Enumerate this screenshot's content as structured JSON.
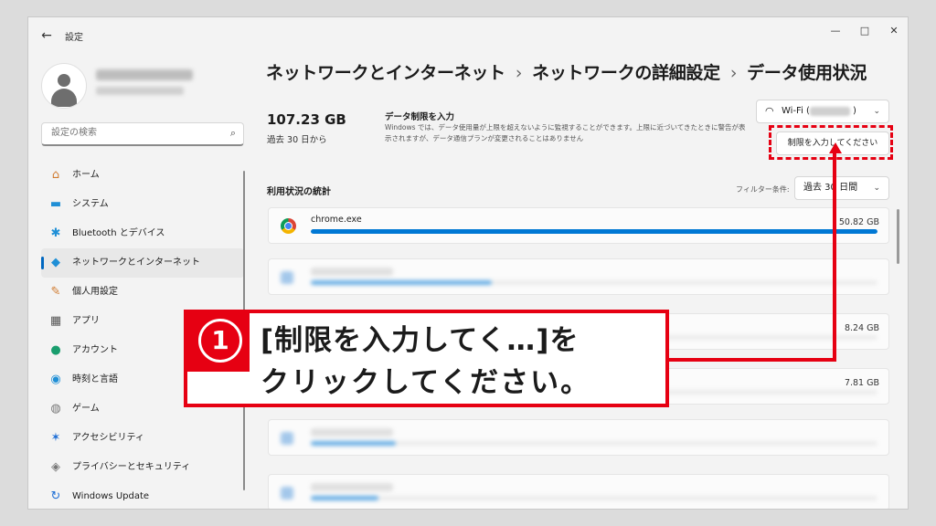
{
  "window": {
    "title": "設定",
    "controls": {
      "minimize": "—",
      "maximize": "□",
      "close": "✕"
    }
  },
  "sidebar": {
    "search_placeholder": "設定の検索",
    "items": [
      {
        "label": "ホーム",
        "icon": "home-icon",
        "glyph": "⌂",
        "color": "#d07a2e",
        "active": false
      },
      {
        "label": "システム",
        "icon": "system-icon",
        "glyph": "▬",
        "color": "#1f8fd6",
        "active": false
      },
      {
        "label": "Bluetooth とデバイス",
        "icon": "bluetooth-icon",
        "glyph": "✱",
        "color": "#1f8fd6",
        "active": false
      },
      {
        "label": "ネットワークとインターネット",
        "icon": "wifi-icon",
        "glyph": "◆",
        "color": "#1f8fd6",
        "active": true
      },
      {
        "label": "個人用設定",
        "icon": "brush-icon",
        "glyph": "✎",
        "color": "#d07a2e",
        "active": false
      },
      {
        "label": "アプリ",
        "icon": "apps-icon",
        "glyph": "▦",
        "color": "#555555",
        "active": false
      },
      {
        "label": "アカウント",
        "icon": "account-icon",
        "glyph": "●",
        "color": "#1a9e6e",
        "active": false
      },
      {
        "label": "時刻と言語",
        "icon": "globe-icon",
        "glyph": "◉",
        "color": "#1f8fd6",
        "active": false
      },
      {
        "label": "ゲーム",
        "icon": "gamepad-icon",
        "glyph": "◍",
        "color": "#777777",
        "active": false
      },
      {
        "label": "アクセシビリティ",
        "icon": "accessibility-icon",
        "glyph": "✶",
        "color": "#1f6fd6",
        "active": false
      },
      {
        "label": "プライバシーとセキュリティ",
        "icon": "shield-icon",
        "glyph": "◈",
        "color": "#777777",
        "active": false
      },
      {
        "label": "Windows Update",
        "icon": "update-icon",
        "glyph": "↻",
        "color": "#1f6fd6",
        "active": false
      }
    ]
  },
  "breadcrumb": {
    "part1": "ネットワークとインターネット",
    "part2": "ネットワークの詳細設定",
    "part3": "データ使用状況",
    "separator": "›"
  },
  "usage": {
    "amount": "107.23 GB",
    "period": "過去 30 日から"
  },
  "data_limit": {
    "title": "データ制限を入力",
    "description": "Windows では、データ使用量が上限を超えないように監視することができます。上限に近づいてきたときに警告が表示されますが、データ通信プランが変更されることはありません",
    "button_label": "制限を入力してください"
  },
  "network_select": {
    "prefix": "Wi-Fi (",
    "suffix": ")"
  },
  "stats": {
    "title": "利用状況の統計",
    "filter_label": "フィルター条件:",
    "filter_value": "過去 30 日間",
    "apps": [
      {
        "name": "chrome.exe",
        "size": "50.82 GB",
        "progress": 1.0,
        "blurred": false,
        "icon": "chrome-icon"
      },
      {
        "name": "",
        "size": "",
        "progress": 0.32,
        "blurred": true,
        "icon": "app-icon"
      },
      {
        "name": "",
        "size": "8.24 GB",
        "progress": 0.22,
        "blurred": true,
        "icon": "app-icon"
      },
      {
        "name": "",
        "size": "7.81 GB",
        "progress": 0.2,
        "blurred": true,
        "icon": "app-icon"
      },
      {
        "name": "",
        "size": "",
        "progress": 0.15,
        "blurred": true,
        "icon": "app-icon"
      },
      {
        "name": "",
        "size": "",
        "progress": 0.12,
        "blurred": true,
        "icon": "app-icon"
      }
    ]
  },
  "annotation": {
    "number": "1",
    "line1": "[制限を入力してく…]を",
    "line2": "クリックしてください。",
    "color": "#e60012"
  },
  "colors": {
    "accent": "#0078d4",
    "highlight": "#e60012"
  }
}
